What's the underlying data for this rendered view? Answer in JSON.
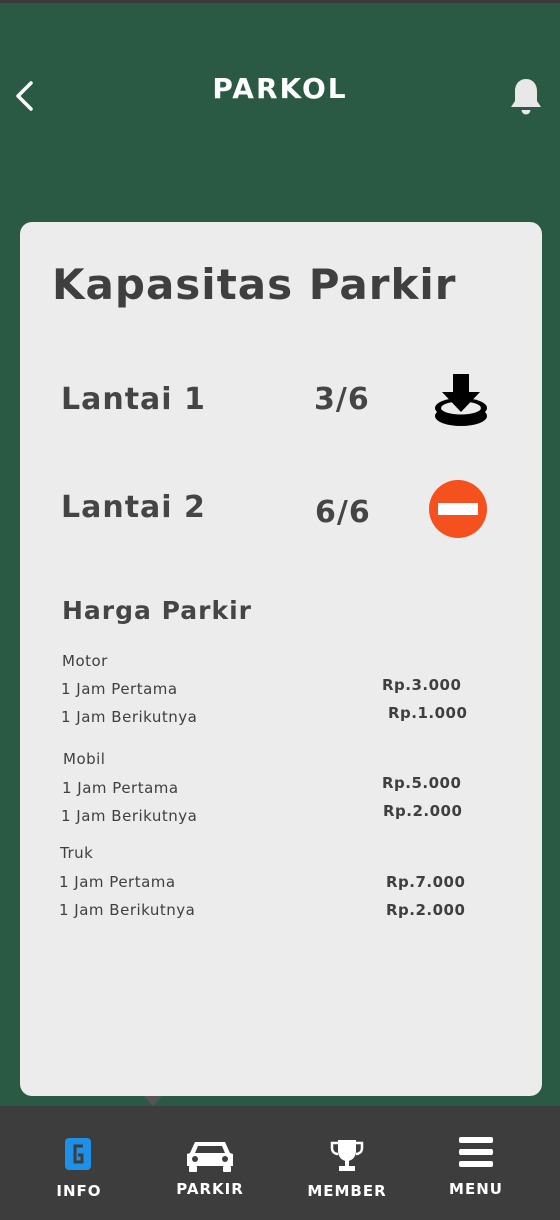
{
  "header": {
    "title": "PARKOL",
    "back_icon": "chevron-left-icon",
    "notification_icon": "bell-icon"
  },
  "capacity": {
    "title": "Kapasitas Parkir",
    "floors": [
      {
        "label": "Lantai 1",
        "value": "3/6",
        "icon": "parking-enter-icon"
      },
      {
        "label": "Lantai 2",
        "value": "6/6",
        "icon": "no-entry-icon"
      }
    ]
  },
  "pricing": {
    "title": "Harga Parkir",
    "categories": [
      {
        "name": "Motor",
        "rows": [
          {
            "label": "1 Jam Pertama",
            "price": "Rp.3.000"
          },
          {
            "label": "1 Jam Berikutnya",
            "price": "Rp.1.000"
          }
        ]
      },
      {
        "name": "Mobil",
        "rows": [
          {
            "label": "1 Jam Pertama",
            "price": "Rp.5.000"
          },
          {
            "label": "1 Jam Berikutnya",
            "price": "Rp.2.000"
          }
        ]
      },
      {
        "name": "Truk",
        "rows": [
          {
            "label": "1 Jam Pertama",
            "price": "Rp.7.000"
          },
          {
            "label": "1 Jam Berikutnya",
            "price": "Rp.2.000"
          }
        ]
      }
    ]
  },
  "nav": {
    "items": [
      {
        "label": "INFO",
        "icon": "info-icon",
        "active": true
      },
      {
        "label": "PARKIR",
        "icon": "car-icon",
        "active": false
      },
      {
        "label": "MEMBER",
        "icon": "trophy-icon",
        "active": false
      },
      {
        "label": "MENU",
        "icon": "hamburger-menu-icon",
        "active": false
      }
    ]
  },
  "colors": {
    "background": "#2b5a44",
    "card": "#ececec",
    "nav_bar": "#3d3d3d",
    "active_icon": "#1e90e8",
    "no_entry": "#f4511e",
    "text": "#454545"
  }
}
